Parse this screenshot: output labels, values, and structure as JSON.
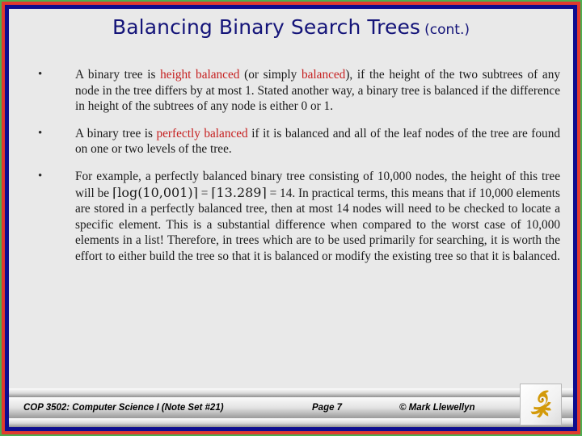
{
  "slide": {
    "title_main": "Balancing Binary Search Trees",
    "title_suffix": "(cont.)",
    "title_color": "#141479",
    "background_color": "#e9e9e9",
    "border_colors": {
      "outer_green": "#4caf50",
      "middle_red": "#e03a2f",
      "inner_navy": "#0d0d8f"
    },
    "highlight_color": "#c62020"
  },
  "bullets": [
    {
      "marker": "•",
      "parts": [
        {
          "text": "A binary tree is ",
          "style": "plain"
        },
        {
          "text": "height balanced",
          "style": "highlight"
        },
        {
          "text": " (or simply ",
          "style": "plain"
        },
        {
          "text": "balanced",
          "style": "highlight"
        },
        {
          "text": "), if the  height of the two subtrees of any node in the tree differs by at most 1.   Stated another way, a binary tree is balanced if the difference in height of the subtrees of any node is either 0 or 1.",
          "style": "plain"
        }
      ]
    },
    {
      "marker": "•",
      "parts": [
        {
          "text": "A binary tree is ",
          "style": "plain"
        },
        {
          "text": "perfectly balanced",
          "style": "highlight"
        },
        {
          "text": " if it is balanced and all of the leaf nodes of the tree are found on one or two levels of the tree.",
          "style": "plain"
        }
      ]
    },
    {
      "marker": "•",
      "parts": [
        {
          "text": "For example, a perfectly balanced binary tree consisting of 10,000 nodes, the height of this tree will be ",
          "style": "plain"
        },
        {
          "text": "⌈log(10,001)⌉",
          "style": "math"
        },
        {
          "text": " = ",
          "style": "plain"
        },
        {
          "text": "⌈13.289⌉",
          "style": "math"
        },
        {
          "text": " = 14.  In practical terms, this means that if 10,000 elements are stored in a perfectly balanced tree, then at most 14 nodes will need to be checked to locate a specific element.   This is a substantial difference when compared to the worst case of 10,000 elements in a list!  Therefore, in trees which are to be used primarily for searching, it is worth the effort to either build the tree so that it is balanced or modify the existing tree so that it is balanced.",
          "style": "plain"
        }
      ]
    }
  ],
  "footer": {
    "course": "COP 3502: Computer Science I  (Note Set #21)",
    "page": "Page 7",
    "copyright": "© Mark Llewellyn"
  },
  "logo": {
    "name": "ucf-pegasus-logo",
    "color": "#d39a0a"
  }
}
